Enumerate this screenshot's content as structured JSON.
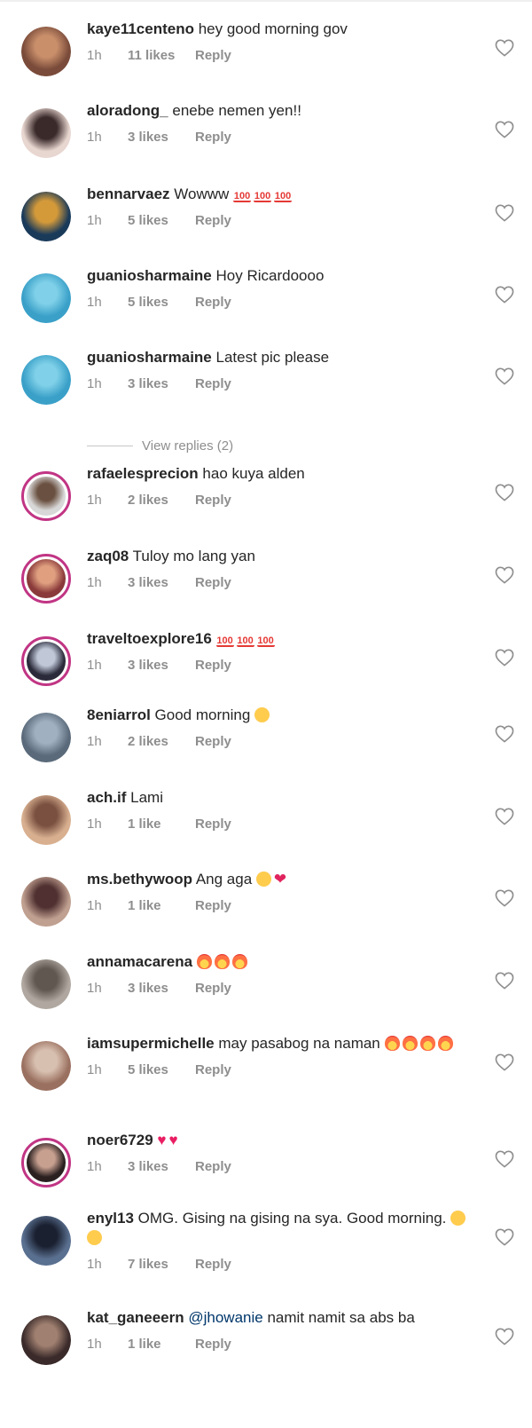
{
  "view_replies_label": "View replies (2)",
  "comments": [
    {
      "username": "kaye11centeno",
      "text": "hey good morning gov",
      "time": "1h",
      "likes": "11 likes",
      "reply": "Reply",
      "emoji": []
    },
    {
      "username": "aloradong_",
      "text": "enebe nemen yen!!",
      "time": "1h",
      "likes": "3 likes",
      "reply": "Reply",
      "emoji": []
    },
    {
      "username": "bennarvaez",
      "text": "Wowww",
      "time": "1h",
      "likes": "5 likes",
      "reply": "Reply",
      "emoji": [
        "100",
        "100",
        "100"
      ]
    },
    {
      "username": "guaniosharmaine",
      "text": "Hoy Ricardoooo",
      "time": "1h",
      "likes": "5 likes",
      "reply": "Reply",
      "emoji": []
    },
    {
      "username": "guaniosharmaine",
      "text": "Latest pic please",
      "time": "1h",
      "likes": "3 likes",
      "reply": "Reply",
      "emoji": []
    },
    {
      "username": "rafaelesprecion",
      "text": "hao kuya alden",
      "time": "1h",
      "likes": "2 likes",
      "reply": "Reply",
      "emoji": []
    },
    {
      "username": "zaq08",
      "text": "Tuloy mo lang yan",
      "time": "1h",
      "likes": "3 likes",
      "reply": "Reply",
      "emoji": []
    },
    {
      "username": "traveltoexplore16",
      "text": "",
      "time": "1h",
      "likes": "3 likes",
      "reply": "Reply",
      "emoji": [
        "100",
        "100",
        "100"
      ]
    },
    {
      "username": "8eniarrol",
      "text": "Good morning",
      "time": "1h",
      "likes": "2 likes",
      "reply": "Reply",
      "emoji": [
        "smile"
      ]
    },
    {
      "username": "ach.if",
      "text": "Lami",
      "time": "1h",
      "likes": "1 like",
      "reply": "Reply",
      "emoji": []
    },
    {
      "username": "ms.bethywoop",
      "text": "Ang aga",
      "time": "1h",
      "likes": "1 like",
      "reply": "Reply",
      "emoji": [
        "smile",
        "heart"
      ]
    },
    {
      "username": "annamacarena",
      "text": "",
      "time": "1h",
      "likes": "3 likes",
      "reply": "Reply",
      "emoji": [
        "fire",
        "fire",
        "fire"
      ]
    },
    {
      "username": "iamsupermichelle",
      "text": "may pasabog na naman",
      "time": "1h",
      "likes": "5 likes",
      "reply": "Reply",
      "emoji": [
        "fire",
        "fire",
        "fire",
        "fire"
      ]
    },
    {
      "username": "noer6729",
      "text": "",
      "time": "1h",
      "likes": "3 likes",
      "reply": "Reply",
      "emoji": [
        "pink",
        "pink"
      ]
    },
    {
      "username": "enyl13",
      "text": "OMG. Gising na gising na sya. Good morning.",
      "time": "1h",
      "likes": "7 likes",
      "reply": "Reply",
      "emoji": [
        "smile",
        "smile"
      ]
    },
    {
      "username": "kat_ganeeern",
      "mention": "@jhowanie",
      "text": "namit namit sa abs ba",
      "time": "1h",
      "likes": "1 like",
      "reply": "Reply",
      "emoji": []
    }
  ],
  "colors": {
    "text": "#262626",
    "meta": "#8e8e8e",
    "mention": "#00376b",
    "story_ring": "#c13584"
  }
}
